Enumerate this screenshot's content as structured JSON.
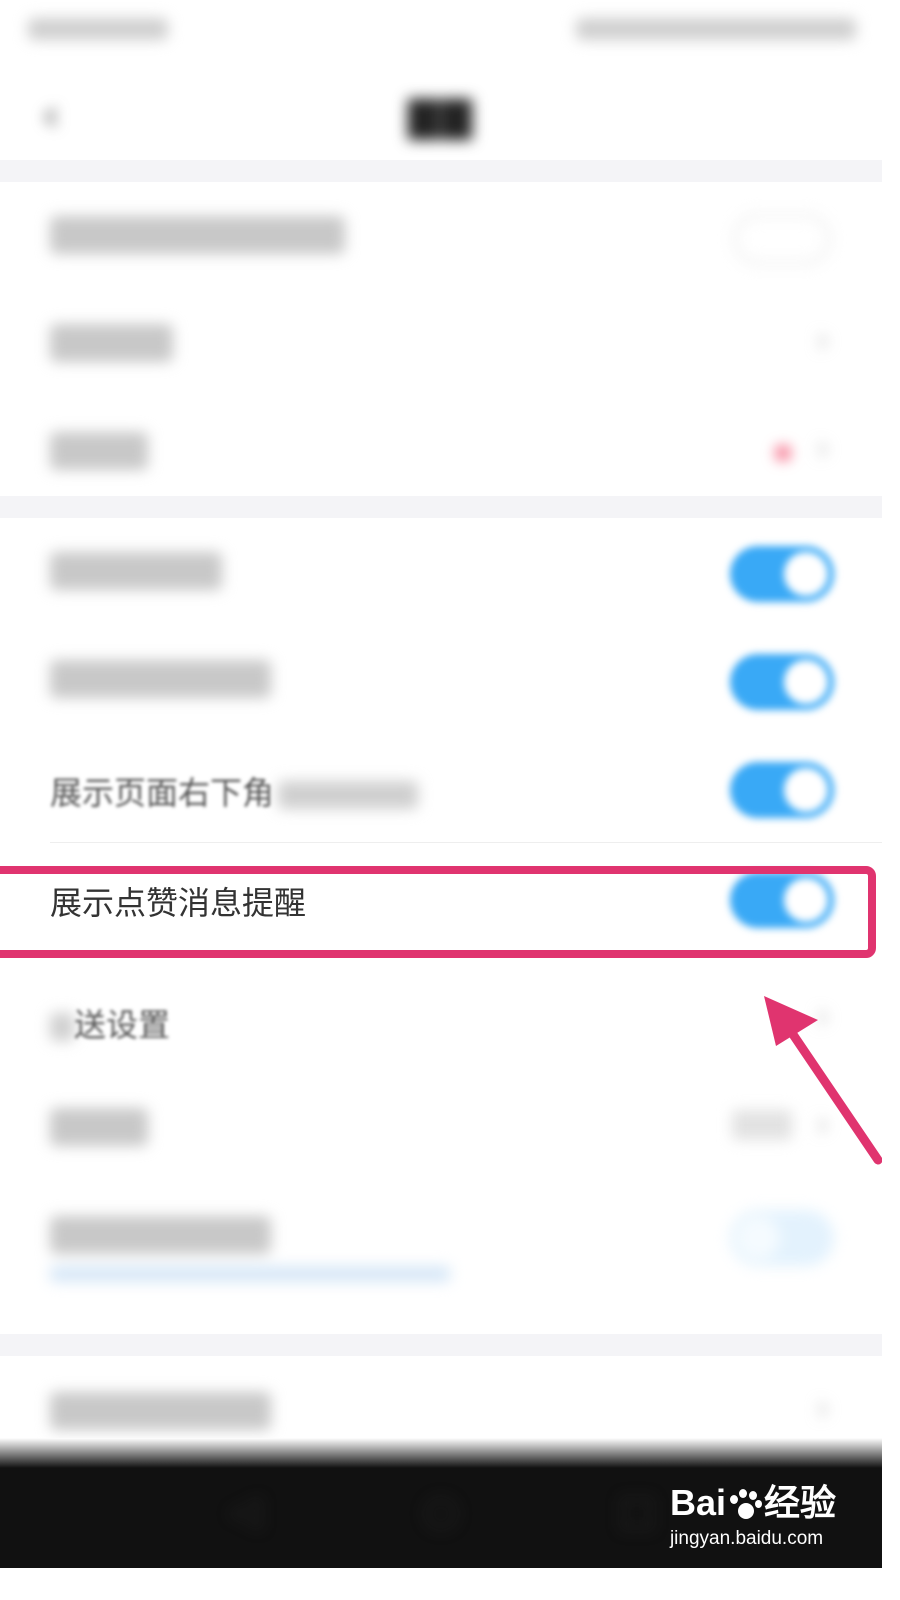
{
  "rows": {
    "corner_refresh_label": "展示页面右下角",
    "like_reminder_label": "展示点赞消息提醒",
    "push_settings_label": "送设置"
  },
  "colors": {
    "toggle_on": "#39a9f6",
    "highlight": "#e0346f",
    "bottom_bar": "#111111"
  },
  "icons": {
    "back": "back-arrow-icon",
    "chevron": "chevron-right-icon",
    "annotation_arrow": "annotation-arrow-icon"
  },
  "watermark": {
    "brand": "Bai",
    "brand_suffix": "经验",
    "url": "jingyan.baidu.com"
  }
}
